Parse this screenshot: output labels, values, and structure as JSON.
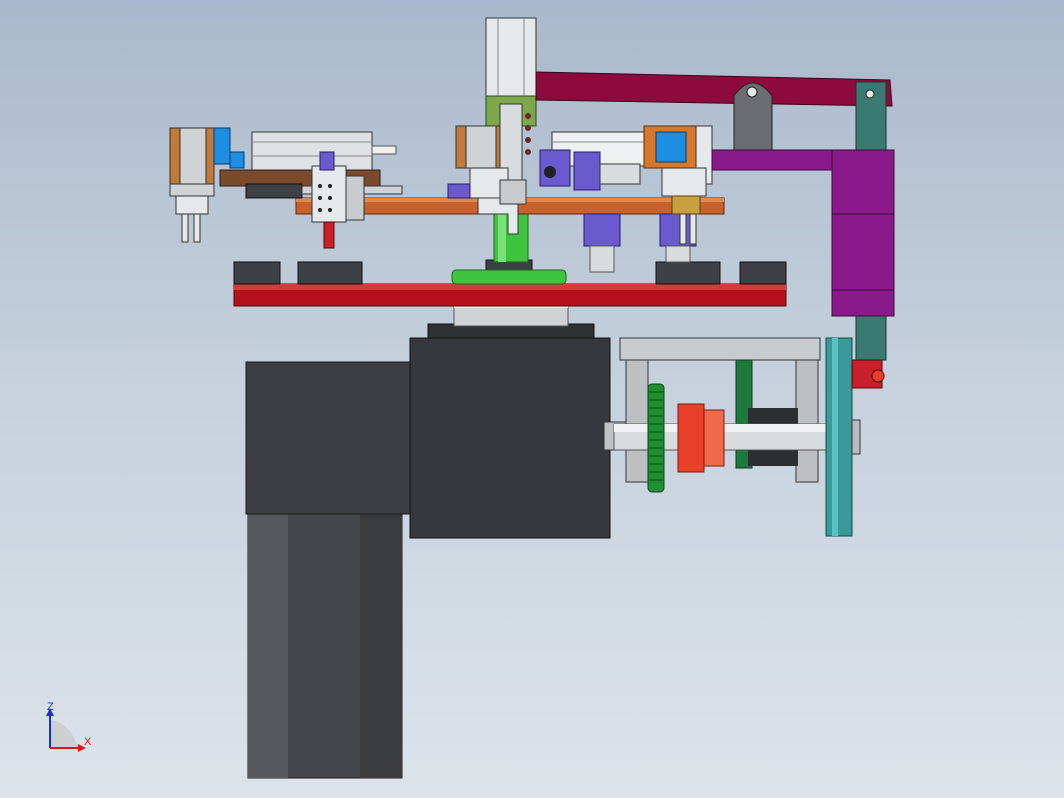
{
  "viewport": {
    "background_top": "#a9b8cc",
    "background_bottom": "#dde3e9"
  },
  "triad": {
    "z_label": "Z",
    "x_label": "X",
    "z_color": "#1a2fd6",
    "x_color": "#d61a1a"
  },
  "colors": {
    "motor_body": "#3b3e42",
    "gearbox": "#35383c",
    "turntable": "#b3121c",
    "top_plate": "#c8622c",
    "arm": "#8c0a3c",
    "magenta_column": "#8a1a8a",
    "pulley": "#3a9a9a",
    "gear": "#1f8f2f",
    "coupling": "#e8402a",
    "shaft": "#d8dcdf",
    "cylinder_green": "#3fc43f",
    "slider_purple": "#6a5acd",
    "orange_block": "#d8782a",
    "olive_green": "#7aa84a",
    "blue_accent": "#1e8fe0",
    "steel": "#c9cccf"
  }
}
